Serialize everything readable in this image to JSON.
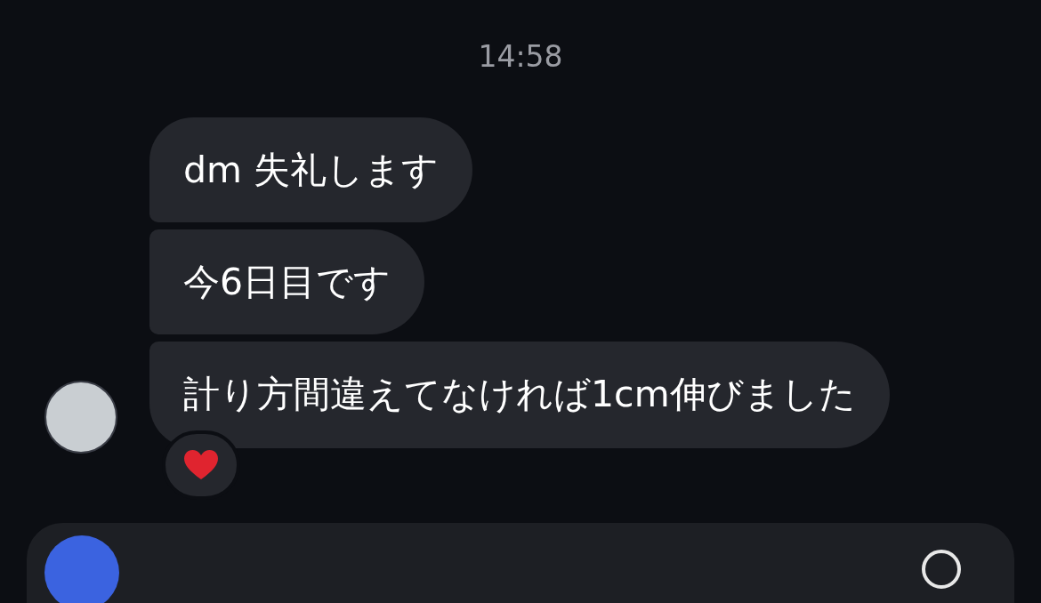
{
  "timestamp": "14:58",
  "messages": [
    {
      "text": "dm 失礼します"
    },
    {
      "text": "今6日目です"
    },
    {
      "text": "計り方間違えてなければ1cm伸びました"
    }
  ]
}
